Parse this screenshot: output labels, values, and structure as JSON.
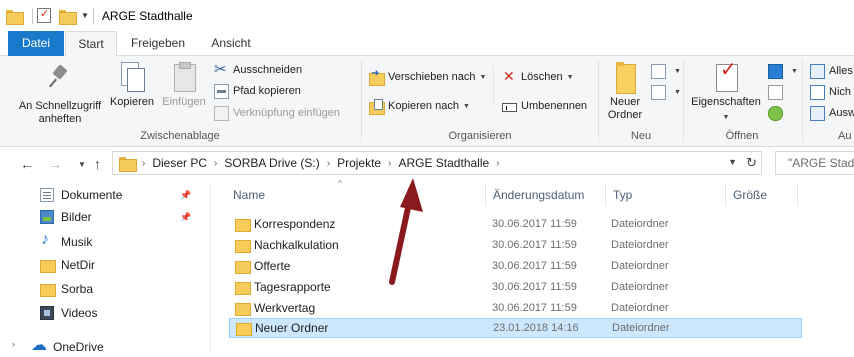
{
  "window": {
    "title": "ARGE Stadthalle"
  },
  "ribbon_tabs": [
    {
      "label": "Datei"
    },
    {
      "label": "Start"
    },
    {
      "label": "Freigeben"
    },
    {
      "label": "Ansicht"
    }
  ],
  "ribbon": {
    "clipboard": {
      "pin_label_1": "An Schnellzugriff",
      "pin_label_2": "anheften",
      "copy_label": "Kopieren",
      "paste_label": "Einfügen",
      "cut_label": "Ausschneiden",
      "copy_path_label": "Pfad kopieren",
      "paste_shortcut_label": "Verknüpfung einfügen",
      "group_label": "Zwischenablage"
    },
    "organize": {
      "move_label": "Verschieben nach",
      "copy_to_label": "Kopieren nach",
      "delete_label": "Löschen",
      "rename_label": "Umbenennen",
      "group_label": "Organisieren"
    },
    "new": {
      "new_folder_label_1": "Neuer",
      "new_folder_label_2": "Ordner",
      "group_label": "Neu"
    },
    "open": {
      "properties_label": "Eigenschaften",
      "group_label": "Öffnen"
    },
    "select": {
      "select_all_label": "Alles",
      "select_none_label": "Nich",
      "invert_label": "Ausw",
      "group_label": "Au"
    }
  },
  "address_bar": {
    "crumbs": [
      "Dieser PC",
      "SORBA Drive (S:)",
      "Projekte",
      "ARGE Stadthalle"
    ],
    "search_placeholder": "\"ARGE Stadth"
  },
  "nav_pane": {
    "items": [
      {
        "label": "Dokumente",
        "icon": "documents-icon"
      },
      {
        "label": "Bilder",
        "icon": "pictures-icon"
      },
      {
        "label": "Musik",
        "icon": "music-icon"
      },
      {
        "label": "NetDir",
        "icon": "folder-icon"
      },
      {
        "label": "Sorba",
        "icon": "folder-icon"
      },
      {
        "label": "Videos",
        "icon": "videos-icon"
      }
    ],
    "onedrive_label": "OneDrive"
  },
  "columns": {
    "name": "Name",
    "date": "Änderungsdatum",
    "type": "Typ",
    "size": "Größe"
  },
  "files": [
    {
      "name": "Korrespondenz",
      "date": "30.06.2017 11:59",
      "type": "Dateiordner"
    },
    {
      "name": "Nachkalkulation",
      "date": "30.06.2017 11:59",
      "type": "Dateiordner"
    },
    {
      "name": "Offerte",
      "date": "30.06.2017 11:59",
      "type": "Dateiordner"
    },
    {
      "name": "Tagesrapporte",
      "date": "30.06.2017 11:59",
      "type": "Dateiordner"
    },
    {
      "name": "Werkvertag",
      "date": "30.06.2017 11:59",
      "type": "Dateiordner"
    },
    {
      "name": "Neuer Ordner",
      "date": "23.01.2018 14:16",
      "type": "Dateiordner",
      "selected": true
    }
  ],
  "colors": {
    "accent": "#1979ca",
    "selection": "#cce8ff",
    "annotation_arrow": "#8b1a1f"
  }
}
